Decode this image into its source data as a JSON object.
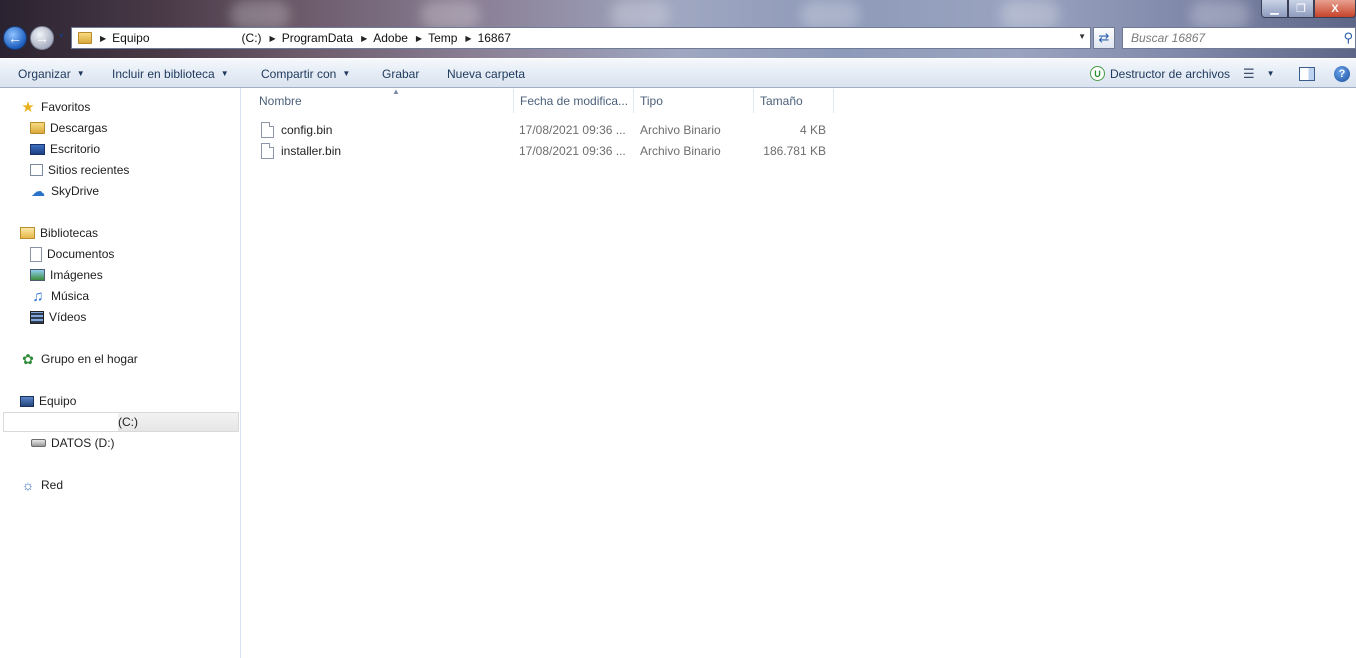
{
  "window": {
    "minimize_label": "▁",
    "maximize_label": "❐",
    "close_label": "X"
  },
  "address": {
    "root": "Equipo",
    "drive": "(C:)",
    "path": [
      "ProgramData",
      "Adobe",
      "Temp",
      "16867"
    ]
  },
  "search": {
    "placeholder": "Buscar 16867"
  },
  "toolbar": {
    "organize": "Organizar",
    "include_library": "Incluir en biblioteca",
    "share_with": "Compartir con",
    "burn": "Grabar",
    "new_folder": "Nueva carpeta",
    "shredder": "Destructor de archivos",
    "shredder_badge": "U"
  },
  "nav": {
    "favorites": "Favoritos",
    "downloads": "Descargas",
    "desktop": "Escritorio",
    "recent_places": "Sitios recientes",
    "skydrive": "SkyDrive",
    "libraries": "Bibliotecas",
    "documents": "Documentos",
    "pictures": "Imágenes",
    "music": "Música",
    "videos": "Vídeos",
    "homegroup": "Grupo en el hogar",
    "computer": "Equipo",
    "drive_c": "(C:)",
    "drive_d": "DATOS (D:)",
    "network": "Red"
  },
  "columns": {
    "name": "Nombre",
    "date": "Fecha de modifica...",
    "type": "Tipo",
    "size": "Tamaño"
  },
  "files": [
    {
      "name": "config.bin",
      "date": "17/08/2021 09:36 ...",
      "type": "Archivo Binario",
      "size": "4 KB"
    },
    {
      "name": "installer.bin",
      "date": "17/08/2021 09:36 ...",
      "type": "Archivo Binario",
      "size": "186.781 KB"
    }
  ],
  "icons": {
    "back": "back-arrow-icon",
    "forward": "forward-arrow-icon",
    "search": "search-icon",
    "help": "help-icon"
  }
}
